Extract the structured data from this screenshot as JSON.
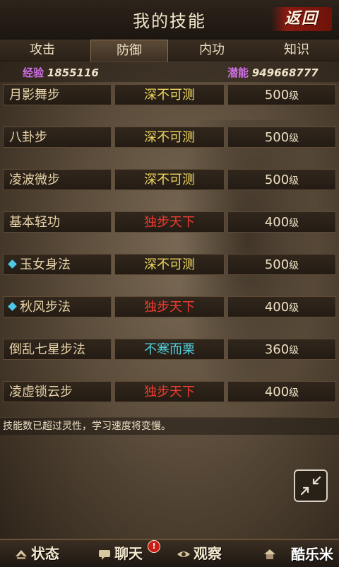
{
  "header": {
    "title": "我的技能",
    "back_label": "返回"
  },
  "tabs": [
    {
      "label": "攻击",
      "active": false
    },
    {
      "label": "防御",
      "active": true
    },
    {
      "label": "内功",
      "active": false
    },
    {
      "label": "知识",
      "active": false
    }
  ],
  "stats": {
    "exp_label": "经验",
    "exp_value": "1855116",
    "potential_label": "潜能",
    "potential_value": "949668777"
  },
  "skills": [
    {
      "name": "月影舞步",
      "rank": "深不可测",
      "rank_color": "#f0d860",
      "level": "500",
      "unit": "级",
      "marked": false
    },
    {
      "name": "八卦步",
      "rank": "深不可测",
      "rank_color": "#f0d860",
      "level": "500",
      "unit": "级",
      "marked": false
    },
    {
      "name": "凌波微步",
      "rank": "深不可测",
      "rank_color": "#f0d860",
      "level": "500",
      "unit": "级",
      "marked": false
    },
    {
      "name": "基本轻功",
      "rank": "独步天下",
      "rank_color": "#f03a30",
      "level": "400",
      "unit": "级",
      "marked": false
    },
    {
      "name": "玉女身法",
      "rank": "深不可测",
      "rank_color": "#f0d860",
      "level": "500",
      "unit": "级",
      "marked": true
    },
    {
      "name": "秋风步法",
      "rank": "独步天下",
      "rank_color": "#f03a30",
      "level": "400",
      "unit": "级",
      "marked": true
    },
    {
      "name": "倒乱七星步法",
      "rank": "不寒而栗",
      "rank_color": "#52d0e0",
      "level": "360",
      "unit": "级",
      "marked": false
    },
    {
      "name": "凌虚锁云步",
      "rank": "独步天下",
      "rank_color": "#f03a30",
      "level": "400",
      "unit": "级",
      "marked": false
    }
  ],
  "notice": "技能数已超过灵性，学习速度将变慢。",
  "bottom_nav": [
    {
      "label": "状态",
      "icon": "status-icon"
    },
    {
      "label": "聊天",
      "icon": "chat-icon",
      "badge": "!"
    },
    {
      "label": "观察",
      "icon": "observe-icon"
    },
    {
      "label": "",
      "icon": "house-icon"
    }
  ],
  "watermark": "酷乐米",
  "collapse_icon": "collapse-arrows-icon"
}
